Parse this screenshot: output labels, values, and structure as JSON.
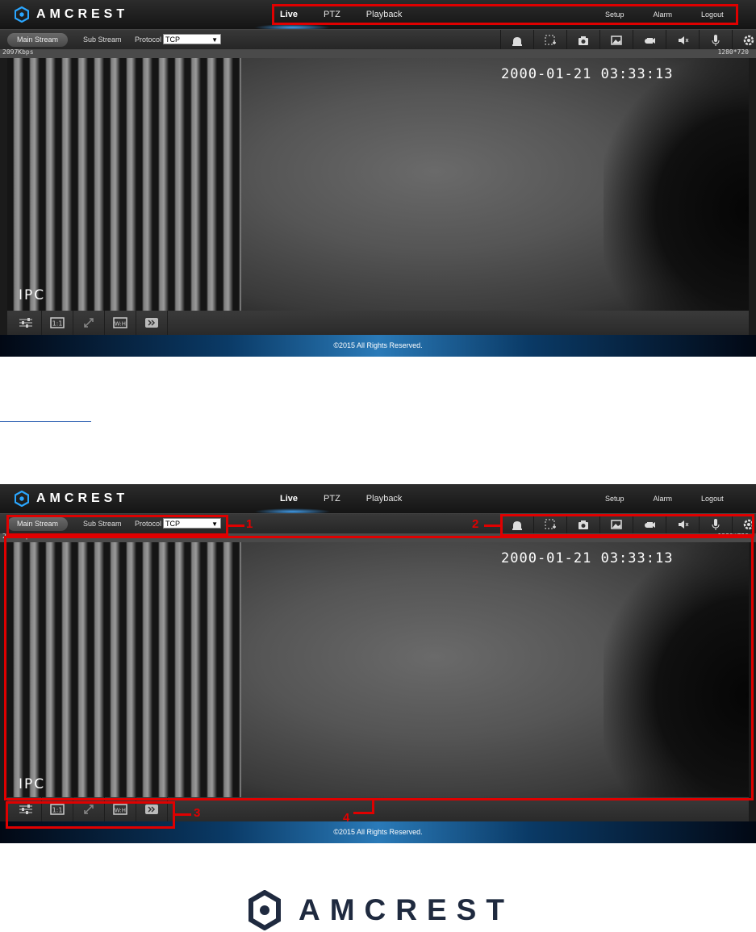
{
  "brand": "AMCREST",
  "nav": {
    "live": "Live",
    "ptz": "PTZ",
    "playback": "Playback",
    "setup": "Setup",
    "alarm": "Alarm",
    "logout": "Logout"
  },
  "toolbar": {
    "main_stream": "Main Stream",
    "sub_stream": "Sub Stream",
    "protocol_label": "Protocol",
    "protocol_value": "TCP"
  },
  "toolbar_icons": [
    "alarm-bell-icon",
    "digital-zoom-icon",
    "snapshot-camera-icon",
    "triple-snapshot-icon",
    "record-icon",
    "audio-mute-icon",
    "microphone-icon",
    "ptz-settings-icon"
  ],
  "video": {
    "bitrate": "2097Kbps",
    "resolution": "1280*720",
    "timestamp": "2000-01-21 03:33:13",
    "osd_label": "IPC"
  },
  "bottom_icons": [
    "image-adjust-icon",
    "original-size-icon",
    "fullscreen-icon",
    "aspect-ratio-icon",
    "fluency-icon"
  ],
  "footer": "©2015 All Rights Reserved.",
  "callouts": {
    "c1": "1",
    "c2": "2",
    "c3": "3",
    "c4": "4"
  },
  "colors": {
    "annotation": "#e00000",
    "footer_glow": "#2a7ab8",
    "logo_dark": "#1f2a3f"
  }
}
